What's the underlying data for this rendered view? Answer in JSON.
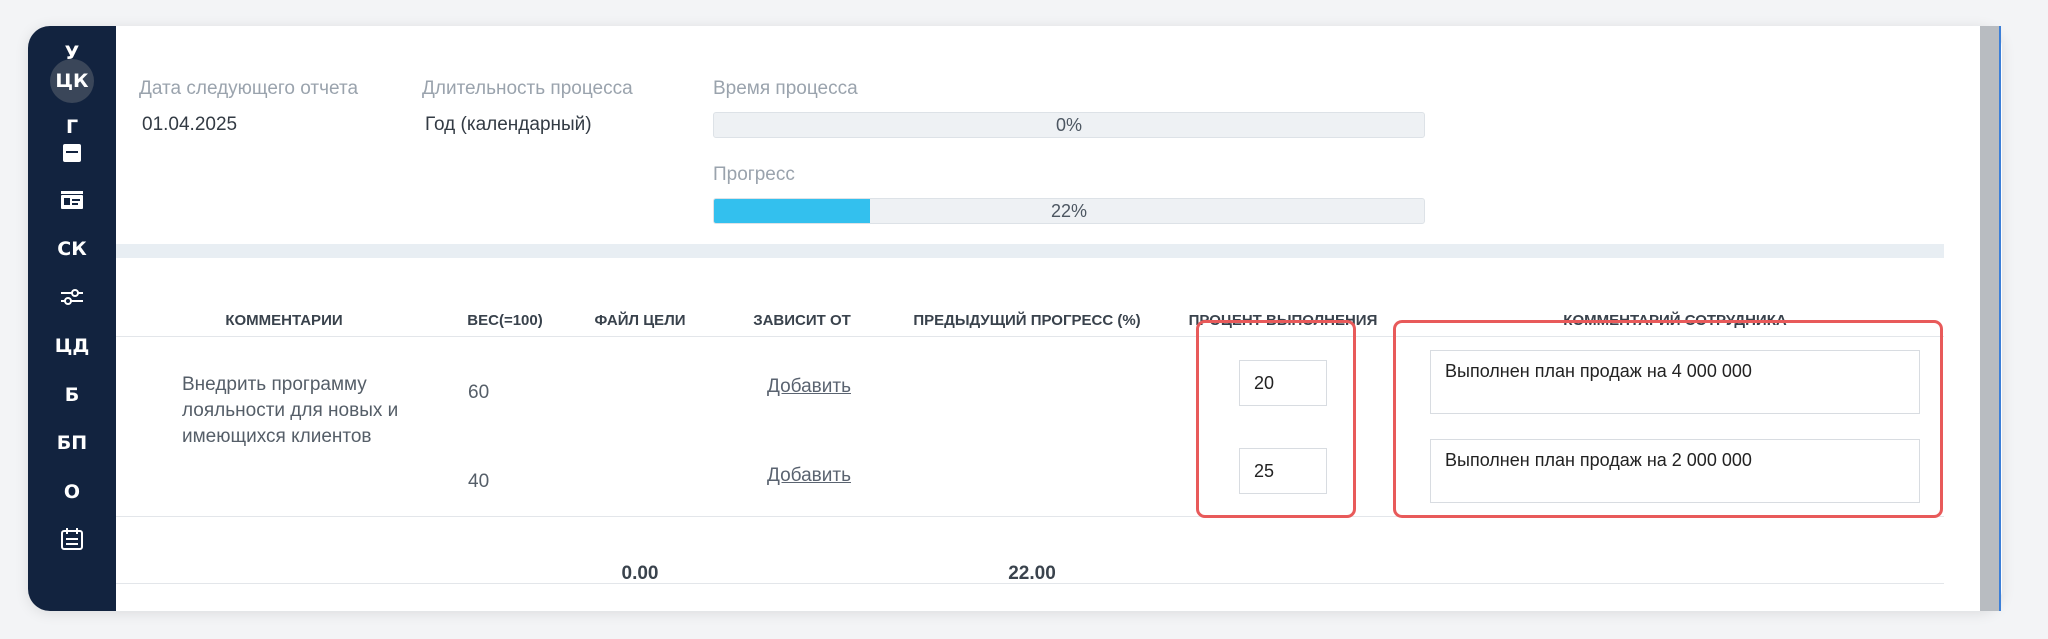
{
  "sidebar": {
    "items": [
      {
        "label": "У"
      },
      {
        "label": "ЦК"
      },
      {
        "label": "Г"
      },
      {
        "icon": "calendar-icon"
      },
      {
        "icon": "id-card-icon"
      },
      {
        "label": "СК"
      },
      {
        "icon": "sliders-icon"
      },
      {
        "label": "ЦД"
      },
      {
        "label": "Б"
      },
      {
        "label": "БП"
      },
      {
        "label": "О"
      },
      {
        "icon": "calendar-list-icon"
      }
    ]
  },
  "info": {
    "next_report_label": "Дата следующего отчета",
    "next_report_value": "01.04.2025",
    "duration_label": "Длительность процесса",
    "duration_value": "Год (календарный)",
    "time_label": "Время процесса",
    "time_percent": 0,
    "time_text": "0%",
    "progress_label": "Прогресс",
    "progress_percent": 22,
    "progress_text": "22%"
  },
  "table": {
    "headers": {
      "comments": "КОММЕНТАРИИ",
      "weight": "ВЕС(=100)",
      "goal_file": "ФАЙЛ ЦЕЛИ",
      "depends_on": "ЗАВИСИТ ОТ",
      "prev_progress": "ПРЕДЫДУЩИЙ ПРОГРЕСС (%)",
      "completion": "ПРОЦЕНТ ВЫПОЛНЕНИЯ",
      "employee_comment": "КОММЕНТАРИЙ СОТРУДНИКА"
    },
    "rows": [
      {
        "comment": "Внедрить программу лояльности для новых и имеющихся клиентов",
        "weight": "60",
        "depends_link": "Добавить",
        "completion": "20",
        "employee_comment": "Выполнен план продаж на 4 000 000"
      },
      {
        "comment": "",
        "weight": "40",
        "depends_link": "Добавить",
        "completion": "25",
        "employee_comment": "Выполнен план продаж на 2 000 000"
      }
    ],
    "totals": {
      "goal_file": "0.00",
      "prev_progress": "22.00"
    }
  },
  "colors": {
    "sidebar_bg": "#12233f",
    "progress_fill": "#33c0ee",
    "highlight": "#e85a5a"
  }
}
